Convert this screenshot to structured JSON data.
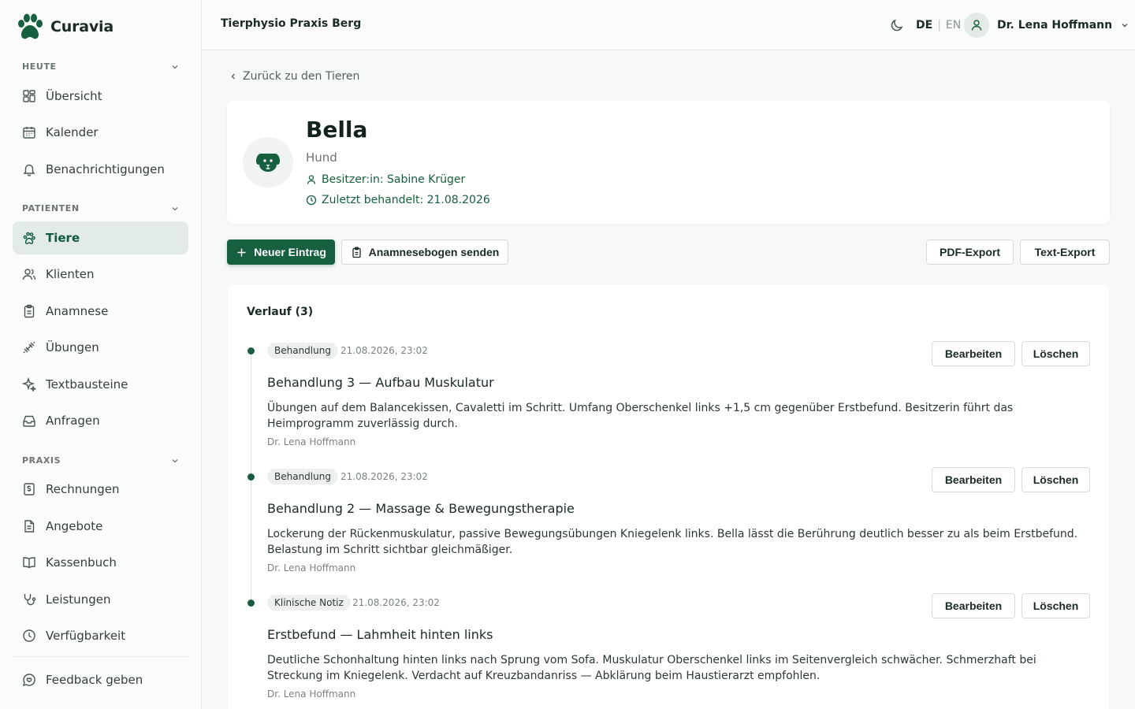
{
  "app": {
    "name": "Curavia"
  },
  "sidebar": {
    "sections": [
      {
        "title": "HEUTE"
      },
      {
        "title": "PATIENTEN"
      },
      {
        "title": "PRAXIS"
      }
    ],
    "items": [
      {
        "label": "Übersicht",
        "icon": "dashboard-icon"
      },
      {
        "label": "Kalender",
        "icon": "calendar-icon"
      },
      {
        "label": "Benachrichtigungen",
        "icon": "bell-icon"
      },
      {
        "label": "Tiere",
        "icon": "paw-icon",
        "active": true
      },
      {
        "label": "Klienten",
        "icon": "users-icon"
      },
      {
        "label": "Anamnese",
        "icon": "clipboard-icon"
      },
      {
        "label": "Übungen",
        "icon": "dumbbell-icon"
      },
      {
        "label": "Textbausteine",
        "icon": "sparkles-icon"
      },
      {
        "label": "Anfragen",
        "icon": "inbox-icon"
      },
      {
        "label": "Rechnungen",
        "icon": "invoice-icon"
      },
      {
        "label": "Angebote",
        "icon": "file-icon"
      },
      {
        "label": "Kassenbuch",
        "icon": "book-icon"
      },
      {
        "label": "Leistungen",
        "icon": "stethoscope-icon"
      },
      {
        "label": "Verfügbarkeit",
        "icon": "clock-icon"
      }
    ],
    "feedback": {
      "label": "Feedback geben",
      "icon": "feedback-icon"
    }
  },
  "header": {
    "practice_name": "Tierphysio Praxis Berg",
    "lang_de": "DE",
    "lang_sep": "|",
    "lang_en": "EN",
    "user_name": "Dr. Lena Hoffmann"
  },
  "main": {
    "back_label": "Zurück zu den Tieren",
    "animal": {
      "name": "Bella",
      "species": "Hund",
      "owner": "Besitzer:in: Sabine Krüger",
      "last_treated": "Zuletzt behandelt: 21.08.2026"
    },
    "actions": {
      "new_entry": "Neuer Eintrag",
      "send_anamnesis": "Anamnesebogen senden",
      "pdf_export": "PDF-Export",
      "text_export": "Text-Export"
    },
    "history": {
      "title": "Verlauf (3)",
      "edit_label": "Bearbeiten",
      "delete_label": "Löschen",
      "entries": [
        {
          "badge": "Behandlung",
          "timestamp": "21.08.2026, 23:02",
          "title": "Behandlung 3 — Aufbau Muskulatur",
          "text": "Übungen auf dem Balancekissen, Cavaletti im Schritt. Umfang Oberschenkel links +1,5 cm gegenüber Erstbefund. Besitzerin führt das Heimprogramm zuverlässig durch.",
          "author": "Dr. Lena Hoffmann"
        },
        {
          "badge": "Behandlung",
          "timestamp": "21.08.2026, 23:02",
          "title": "Behandlung 2 — Massage & Bewegungstherapie",
          "text": "Lockerung der Rückenmuskulatur, passive Bewegungsübungen Kniegelenk links. Bella lässt die Berührung deutlich besser zu als beim Erstbefund. Belastung im Schritt sichtbar gleichmäßiger.",
          "author": "Dr. Lena Hoffmann"
        },
        {
          "badge": "Klinische Notiz",
          "timestamp": "21.08.2026, 23:02",
          "title": "Erstbefund — Lahmheit hinten links",
          "text": "Deutliche Schonhaltung hinten links nach Sprung vom Sofa. Muskulatur Oberschenkel links im Seitenvergleich schwächer. Schmerzhaft bei Streckung im Kniegelenk. Verdacht auf Kreuzbandanriss — Abklärung beim Haustierarzt empfohlen.",
          "author": "Dr. Lena Hoffmann"
        }
      ]
    }
  },
  "colors": {
    "brand": "#17603f",
    "active_bg": "#e3ebe7"
  }
}
